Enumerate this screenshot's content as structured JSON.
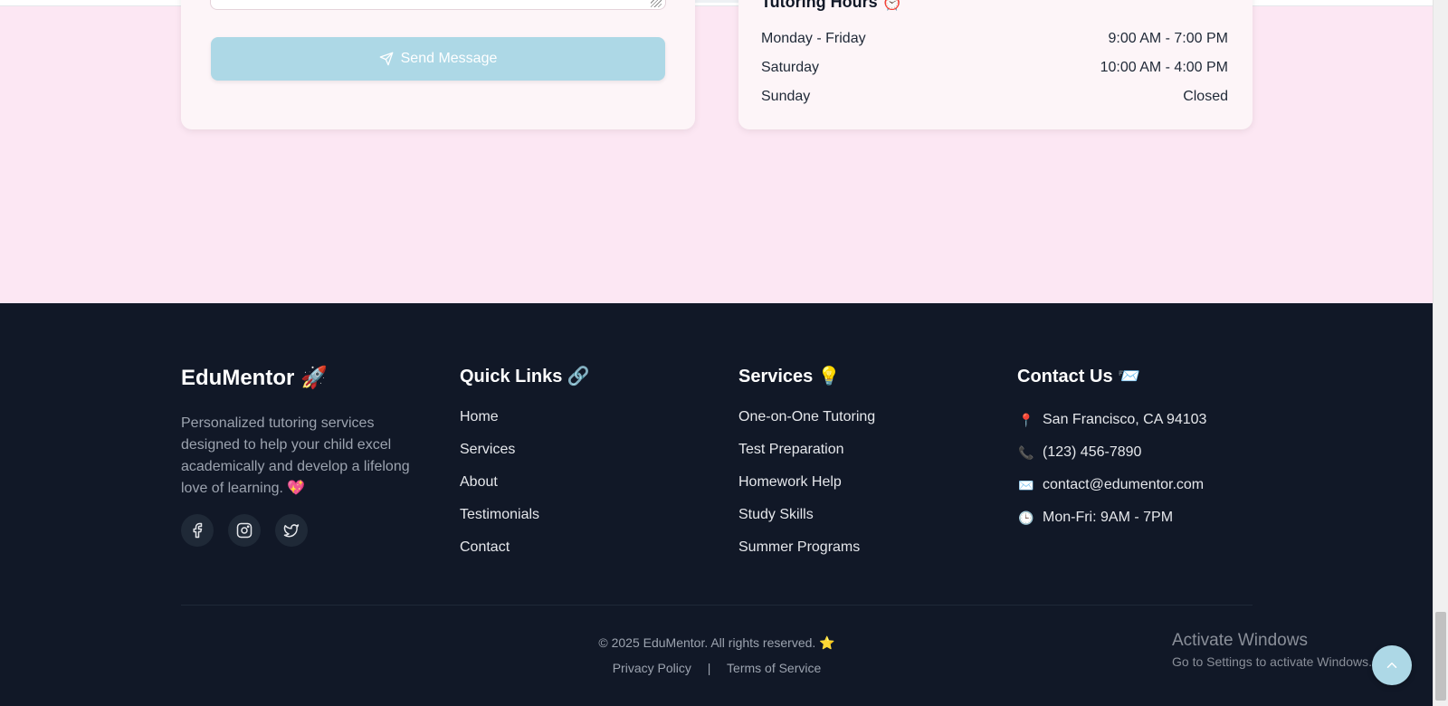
{
  "contact_form": {
    "send_label": "Send Message"
  },
  "hours": {
    "title": "Tutoring Hours ⏰",
    "rows": [
      {
        "day": "Monday - Friday",
        "time": "9:00 AM - 7:00 PM"
      },
      {
        "day": "Saturday",
        "time": "10:00 AM - 4:00 PM"
      },
      {
        "day": "Sunday",
        "time": "Closed"
      }
    ]
  },
  "footer": {
    "brand": {
      "title": "EduMentor 🚀",
      "description": "Personalized tutoring services designed to help your child excel academically and develop a lifelong love of learning. 💖",
      "socials": [
        "facebook-icon",
        "instagram-icon",
        "twitter-icon"
      ]
    },
    "quick_links": {
      "title": "Quick Links 🔗",
      "items": [
        "Home",
        "Services",
        "About",
        "Testimonials",
        "Contact"
      ]
    },
    "services": {
      "title": "Services 💡",
      "items": [
        "One-on-One Tutoring",
        "Test Preparation",
        "Homework Help",
        "Study Skills",
        "Summer Programs"
      ]
    },
    "contact": {
      "title": "Contact Us 📨",
      "items": [
        {
          "icon": "📍",
          "text": "San Francisco, CA 94103"
        },
        {
          "icon": "📞",
          "text": "(123) 456-7890"
        },
        {
          "icon": "✉️",
          "text": "contact@edumentor.com"
        },
        {
          "icon": "🕒",
          "text": "Mon-Fri: 9AM - 7PM"
        }
      ]
    },
    "copyright": "© 2025 EduMentor. All rights reserved. ⭐",
    "privacy": "Privacy Policy",
    "separator": "|",
    "terms": "Terms of Service"
  },
  "windows_watermark": {
    "line1": "Activate Windows",
    "line2": "Go to Settings to activate Windows."
  },
  "colors": {
    "page_bg": "#fce7f3",
    "footer_bg": "#111827",
    "accent": "#add8e6"
  }
}
